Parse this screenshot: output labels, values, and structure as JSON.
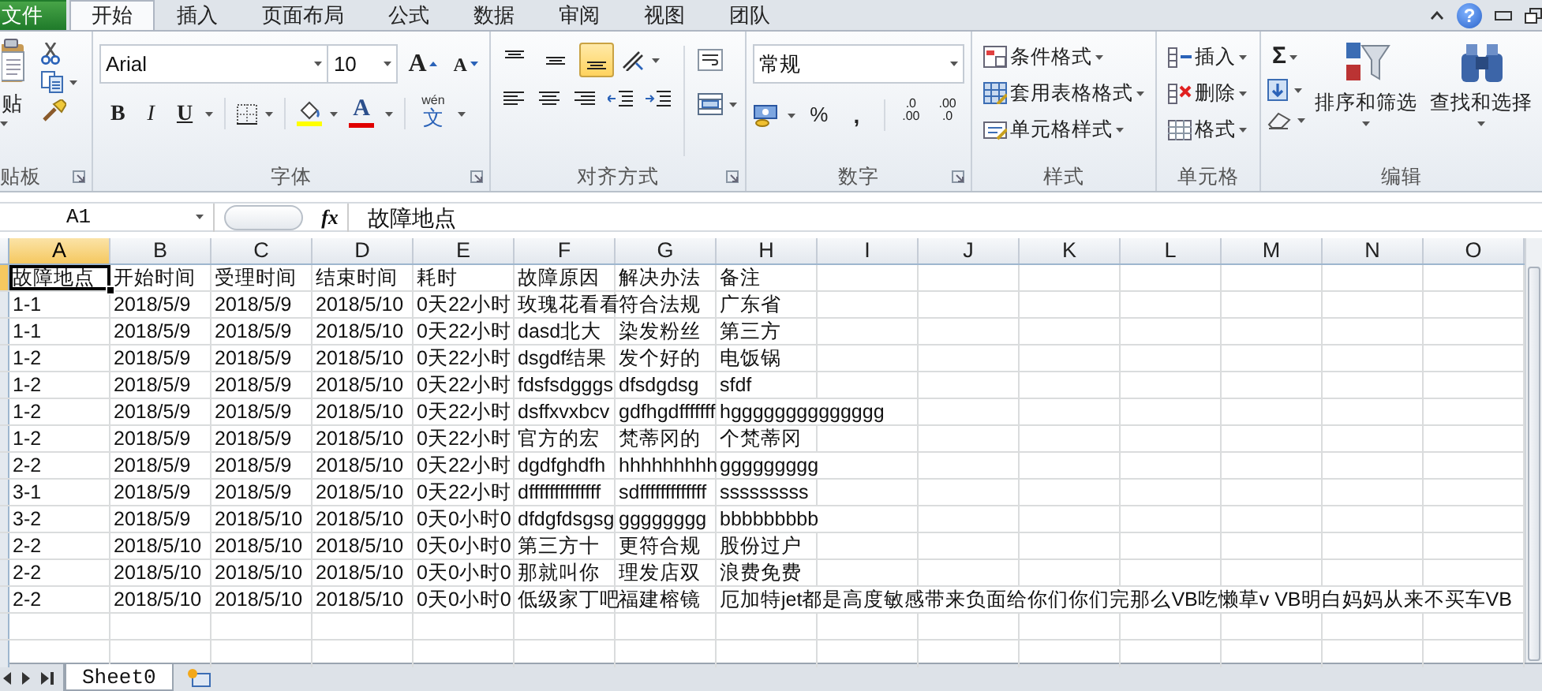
{
  "tabs": [
    {
      "label": "文件",
      "kind": "file",
      "selected": false
    },
    {
      "label": "开始",
      "kind": "tab",
      "selected": true
    },
    {
      "label": "插入",
      "kind": "tab",
      "selected": false
    },
    {
      "label": "页面布局",
      "kind": "tab",
      "selected": false
    },
    {
      "label": "公式",
      "kind": "tab",
      "selected": false
    },
    {
      "label": "数据",
      "kind": "tab",
      "selected": false
    },
    {
      "label": "审阅",
      "kind": "tab",
      "selected": false
    },
    {
      "label": "视图",
      "kind": "tab",
      "selected": false
    },
    {
      "label": "团队",
      "kind": "tab",
      "selected": false
    }
  ],
  "window_controls": {
    "help": "?"
  },
  "clipboard": {
    "paste": "贴",
    "label": "贴板"
  },
  "font": {
    "name": "Arial",
    "size": "10",
    "grow": "A",
    "shrink": "A",
    "bold": "B",
    "italic": "I",
    "underline": "U",
    "color_letter": "A",
    "phonetic_top": "wén",
    "phonetic_char": "文",
    "label": "字体"
  },
  "alignment": {
    "label": "对齐方式",
    "vertical": [
      {
        "kind": "top",
        "selected": false
      },
      {
        "kind": "middle",
        "selected": false
      },
      {
        "kind": "bottom",
        "selected": true
      }
    ]
  },
  "number": {
    "format": "常规",
    "percent": "%",
    "comma": ",",
    "decimals": [
      {
        "top": ".0",
        "bottom": ".00"
      },
      {
        "top": ".00",
        "bottom": ".0"
      }
    ],
    "label": "数字"
  },
  "styles": {
    "items": [
      "条件格式",
      "套用表格格式",
      "单元格样式"
    ],
    "label": "样式"
  },
  "cells": {
    "items": [
      "插入",
      "删除",
      "格式"
    ],
    "label": "单元格"
  },
  "editing": {
    "sum": "Σ",
    "sort": "排序和筛选",
    "find": "查找和选择",
    "label": "编辑"
  },
  "formula_bar": {
    "name_box": "A1",
    "fx": "fx",
    "content": "故障地点"
  },
  "grid": {
    "columns": [
      {
        "label": "A",
        "selected": true
      },
      {
        "label": "B",
        "selected": false
      },
      {
        "label": "C",
        "selected": false
      },
      {
        "label": "D",
        "selected": false
      },
      {
        "label": "E",
        "selected": false
      },
      {
        "label": "F",
        "selected": false
      },
      {
        "label": "G",
        "selected": false
      },
      {
        "label": "H",
        "selected": false
      },
      {
        "label": "I",
        "selected": false
      },
      {
        "label": "J",
        "selected": false
      },
      {
        "label": "K",
        "selected": false
      },
      {
        "label": "L",
        "selected": false
      },
      {
        "label": "M",
        "selected": false
      },
      {
        "label": "N",
        "selected": false
      },
      {
        "label": "O",
        "selected": false
      }
    ],
    "rows": [
      {
        "selected": true,
        "cells": [
          "故障地点",
          "开始时间",
          "受理时间",
          "结束时间",
          "耗时",
          "故障原因",
          "解决办法",
          "备注"
        ]
      },
      {
        "selected": false,
        "cells": [
          "1-1",
          "2018/5/9",
          "2018/5/9",
          "2018/5/10",
          "0天22小时",
          "玫瑰花看看",
          "符合法规",
          "广东省"
        ]
      },
      {
        "selected": false,
        "cells": [
          "1-1",
          "2018/5/9",
          "2018/5/9",
          "2018/5/10",
          "0天22小时",
          "dasd北大",
          "染发粉丝",
          "第三方"
        ]
      },
      {
        "selected": false,
        "cells": [
          "1-2",
          "2018/5/9",
          "2018/5/9",
          "2018/5/10",
          "0天22小时",
          "dsgdf结果",
          "发个好的",
          "电饭锅"
        ]
      },
      {
        "selected": false,
        "cells": [
          "1-2",
          "2018/5/9",
          "2018/5/9",
          "2018/5/10",
          "0天22小时",
          "fdsfsdgggs",
          "dfsdgdsg",
          "sfdf"
        ]
      },
      {
        "selected": false,
        "cells": [
          "1-2",
          "2018/5/9",
          "2018/5/9",
          "2018/5/10",
          "0天22小时",
          "dsffxvxbcv",
          "gdfhgdfffffff",
          "hgggggggggggggg"
        ]
      },
      {
        "selected": false,
        "cells": [
          "1-2",
          "2018/5/9",
          "2018/5/9",
          "2018/5/10",
          "0天22小时",
          "官方的宏",
          "梵蒂冈的",
          "个梵蒂冈"
        ]
      },
      {
        "selected": false,
        "cells": [
          "2-2",
          "2018/5/9",
          "2018/5/9",
          "2018/5/10",
          "0天22小时",
          "dgdfghdfh",
          "hhhhhhhhh",
          "ggggggggg"
        ]
      },
      {
        "selected": false,
        "cells": [
          "3-1",
          "2018/5/9",
          "2018/5/9",
          "2018/5/10",
          "0天22小时",
          "dffffffffffffff",
          "sdfffffffffffff",
          "sssssssss"
        ]
      },
      {
        "selected": false,
        "cells": [
          "3-2",
          "2018/5/9",
          "2018/5/10",
          "2018/5/10",
          "0天0小时0",
          "dfdgfdsgsg",
          "gggggggg",
          "bbbbbbbbb"
        ]
      },
      {
        "selected": false,
        "cells": [
          "2-2",
          "2018/5/10",
          "2018/5/10",
          "2018/5/10",
          "0天0小时0",
          "第三方十",
          "更符合规",
          "股份过户"
        ]
      },
      {
        "selected": false,
        "cells": [
          "2-2",
          "2018/5/10",
          "2018/5/10",
          "2018/5/10",
          "0天0小时0",
          "那就叫你",
          "理发店双",
          "浪费免费"
        ]
      },
      {
        "selected": false,
        "cells": [
          "2-2",
          "2018/5/10",
          "2018/5/10",
          "2018/5/10",
          "0天0小时0",
          "低级家丁吧",
          "福建榕镜",
          "厄加特jet都是高度敏感带来负面给你们你们完那么VB吃懒草v  VB明白妈妈从来不买车VB"
        ]
      }
    ]
  },
  "sheets": [
    {
      "label": "Sheet0",
      "selected": true
    }
  ]
}
